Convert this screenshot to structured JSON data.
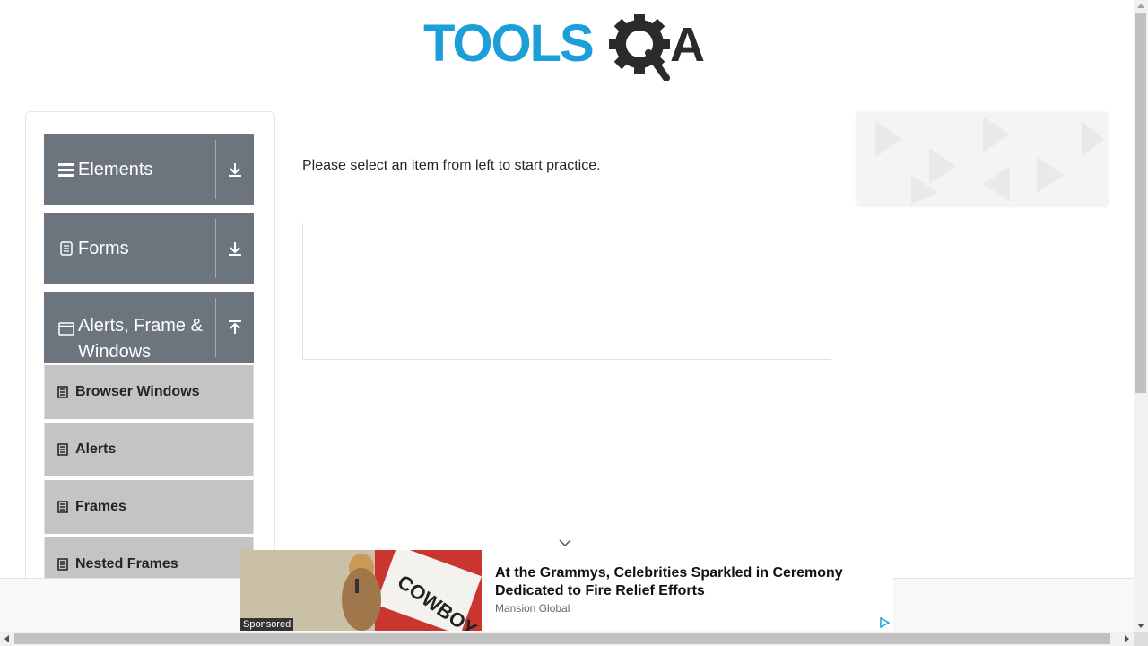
{
  "logo": {
    "text_tools": "TOOLS",
    "text_q": "Q",
    "text_a": "A",
    "primary_color": "#1a9fd9",
    "secondary_color": "#2b2b2b"
  },
  "sidebar": {
    "groups": [
      {
        "label": "Elements",
        "icon": "hamburger-icon",
        "toggle_icon": "download-arrow-icon"
      },
      {
        "label": "Forms",
        "icon": "document-icon",
        "toggle_icon": "download-arrow-icon"
      },
      {
        "label": "Alerts, Frame & Windows",
        "icon": "window-icon",
        "toggle_icon": "upload-arrow-icon"
      }
    ],
    "submenu": [
      {
        "label": "Browser Windows",
        "icon": "list-item-icon"
      },
      {
        "label": "Alerts",
        "icon": "list-item-icon"
      },
      {
        "label": "Frames",
        "icon": "list-item-icon"
      },
      {
        "label": "Nested Frames",
        "icon": "list-item-icon"
      }
    ]
  },
  "main": {
    "instruction": "Please select an item from left to start practice."
  },
  "ad": {
    "title": "At the Grammys, Celebrities Sparkled in Ceremony Dedicated to Fire Relief Efforts",
    "source": "Mansion Global",
    "sponsored": "Sponsored",
    "image_text": "COWBOY"
  },
  "colors": {
    "group_bg": "#6c757d",
    "submenu_bg": "#c4c4c4"
  }
}
